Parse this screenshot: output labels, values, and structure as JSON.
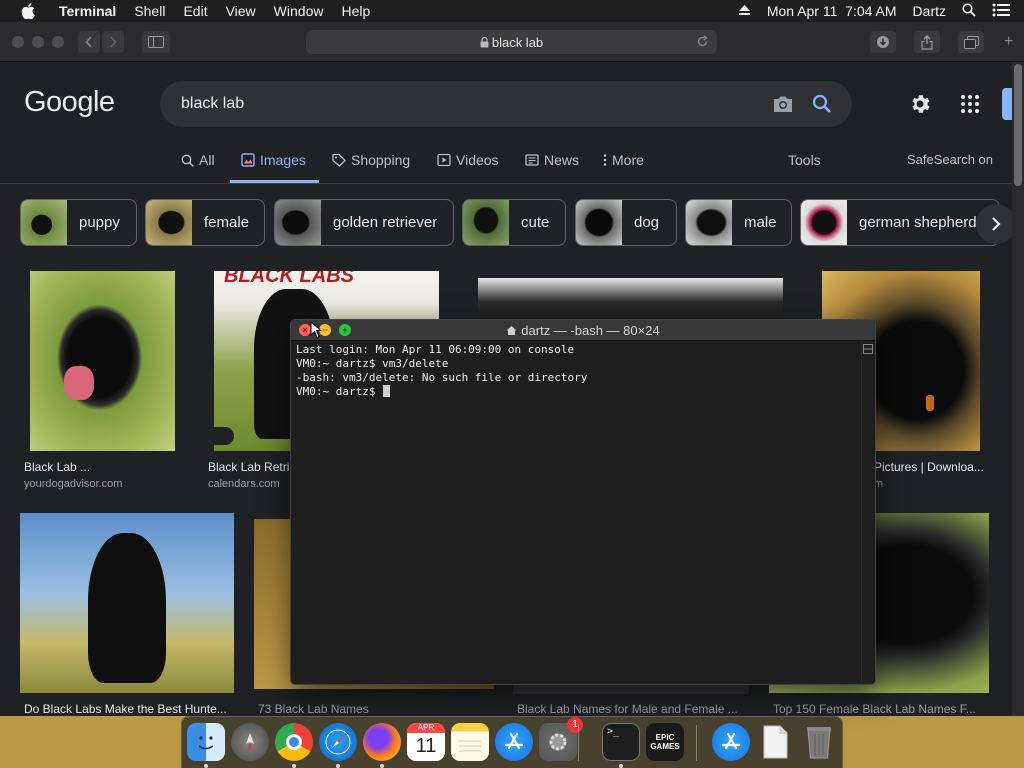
{
  "menubar": {
    "app_name": "Terminal",
    "items": [
      "Shell",
      "Edit",
      "View",
      "Window",
      "Help"
    ],
    "datetime": "Mon Apr 11  7:04 AM",
    "user": "Dartz"
  },
  "browser": {
    "url": "black lab",
    "google": {
      "logo": "Google",
      "query": "black lab",
      "tabs": [
        {
          "label": "All",
          "icon": "search-icon",
          "active": false
        },
        {
          "label": "Images",
          "icon": "image-icon",
          "active": true
        },
        {
          "label": "Shopping",
          "icon": "tag-icon",
          "active": false
        },
        {
          "label": "Videos",
          "icon": "play-icon",
          "active": false
        },
        {
          "label": "News",
          "icon": "news-icon",
          "active": false
        },
        {
          "label": "More",
          "icon": "more-vert-icon",
          "active": false
        }
      ],
      "tools_label": "Tools",
      "safesearch_label": "SafeSearch on",
      "chips": [
        "puppy",
        "female",
        "golden retriever",
        "cute",
        "dog",
        "male",
        "german shepherd"
      ],
      "results": [
        {
          "title": "Black Lab ...",
          "source": "yourdogadvisor.com"
        },
        {
          "title": "Black Lab Retri",
          "source": "calendars.com"
        },
        {
          "title": "Pictures | Downloa...",
          "source": "m"
        },
        {
          "title": "Do Black Labs Make the Best Hunte...",
          "source": ""
        },
        {
          "title": "73 Black Lab Names",
          "source": ""
        },
        {
          "title": "Black Lab Names for Male and Female ...",
          "source": ""
        },
        {
          "title": "Top 150 Female Black Lab Names F...",
          "source": ""
        }
      ],
      "calendar_text": "BLACK LABS"
    }
  },
  "terminal": {
    "title": "dartz — -bash — 80×24",
    "lines": [
      "Last login: Mon Apr 11 06:09:00 on console",
      "VM0:~ dartz$ vm3/delete",
      "-bash: vm3/delete: No such file or directory",
      "VM0:~ dartz$ "
    ]
  },
  "dock": {
    "apps": [
      "Finder",
      "Launchpad",
      "Chrome",
      "Safari",
      "Firefox",
      "Calendar",
      "Notes",
      "App Store",
      "System Preferences",
      "Terminal",
      "Epic Games",
      "App Store",
      "Document",
      "Trash"
    ],
    "calendar_month": "APR",
    "calendar_day": "11",
    "epic_label": "EPIC GAMES",
    "prefs_badge": "1"
  },
  "colors": {
    "google_bg": "#202124",
    "accent": "#8ab4f8",
    "terminal_bg": "#1e1e1e"
  }
}
